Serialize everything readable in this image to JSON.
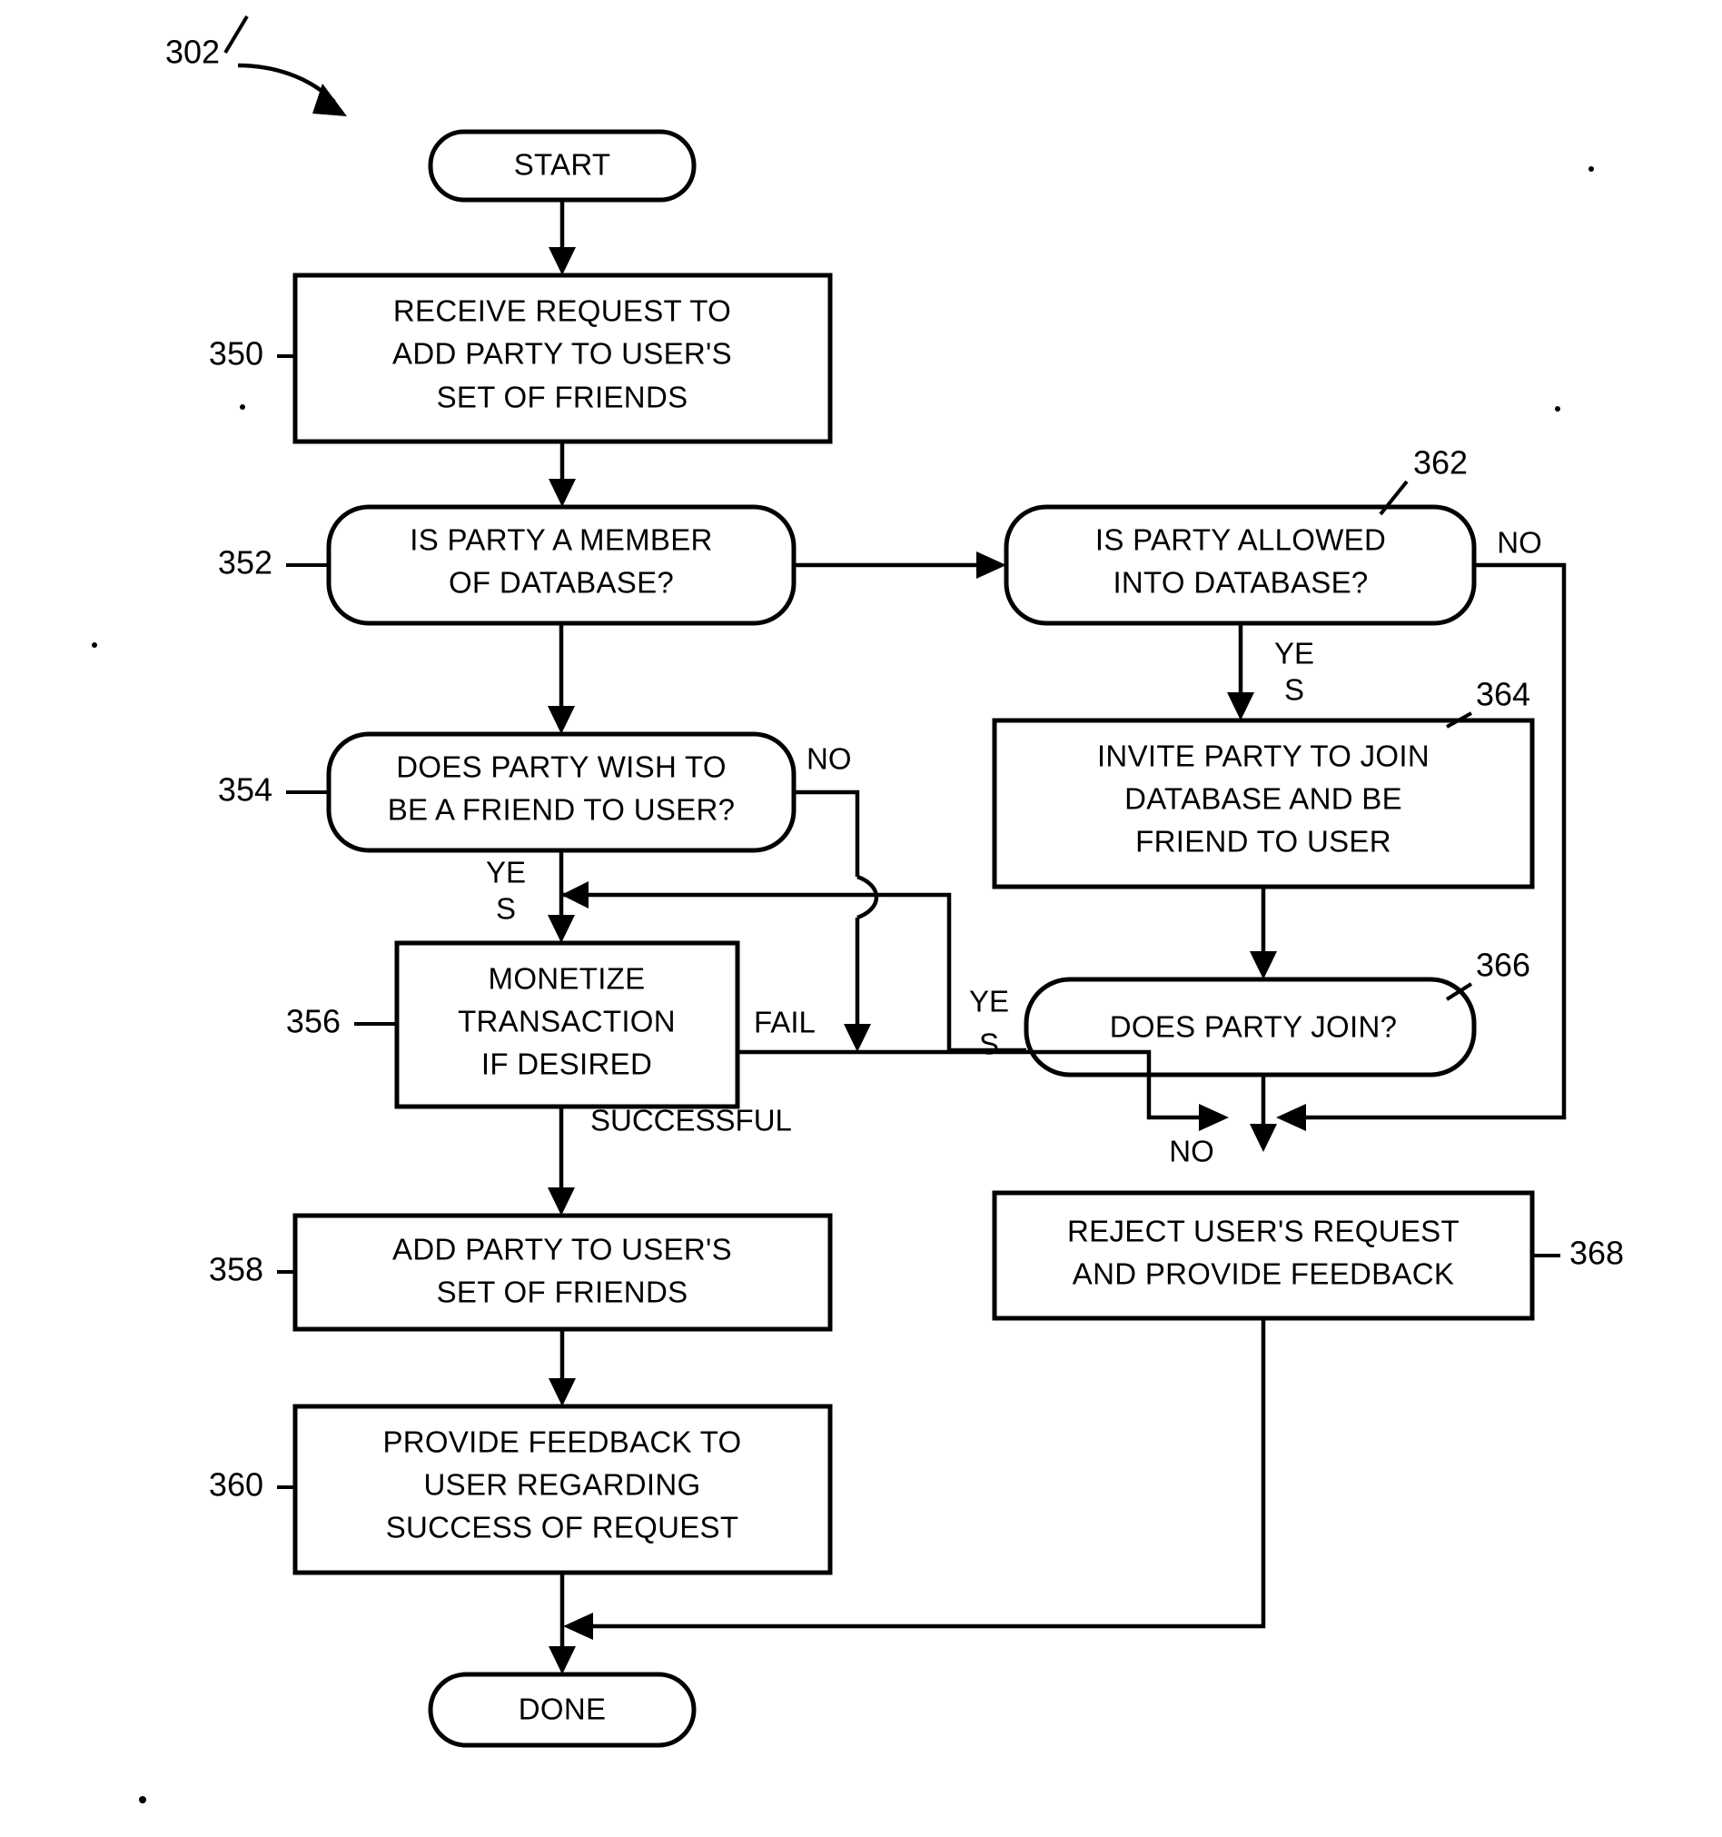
{
  "figure": {
    "reference_numeral": "302"
  },
  "nodes": {
    "start": {
      "label": "START",
      "shape": "rounded-terminal"
    },
    "n350": {
      "ref": "350",
      "lines": [
        "RECEIVE REQUEST TO",
        "ADD PARTY TO USER'S",
        "SET OF FRIENDS"
      ],
      "shape": "rectangle"
    },
    "n352": {
      "ref": "352",
      "lines": [
        "IS PARTY A MEMBER",
        "OF DATABASE?"
      ],
      "shape": "rounded-decision"
    },
    "n354": {
      "ref": "354",
      "lines": [
        "DOES PARTY WISH TO",
        "BE A FRIEND TO USER?"
      ],
      "shape": "rounded-decision"
    },
    "n356": {
      "ref": "356",
      "lines": [
        "MONETIZE",
        "TRANSACTION",
        "IF DESIRED"
      ],
      "shape": "rectangle"
    },
    "n358": {
      "ref": "358",
      "lines": [
        "ADD PARTY TO USER'S",
        "SET OF FRIENDS"
      ],
      "shape": "rectangle"
    },
    "n360": {
      "ref": "360",
      "lines": [
        "PROVIDE FEEDBACK TO",
        "USER REGARDING",
        "SUCCESS OF REQUEST"
      ],
      "shape": "rectangle"
    },
    "n362": {
      "ref": "362",
      "lines": [
        "IS PARTY ALLOWED",
        "INTO DATABASE?"
      ],
      "shape": "rounded-decision"
    },
    "n364": {
      "ref": "364",
      "lines": [
        "INVITE PARTY TO JOIN",
        "DATABASE AND BE",
        "FRIEND TO USER"
      ],
      "shape": "rectangle"
    },
    "n366": {
      "ref": "366",
      "lines": [
        "DOES PARTY JOIN?"
      ],
      "shape": "rounded-decision"
    },
    "n368": {
      "ref": "368",
      "lines": [
        "REJECT USER'S REQUEST",
        "AND PROVIDE FEEDBACK"
      ],
      "shape": "rectangle"
    },
    "done": {
      "label": "DONE",
      "shape": "rounded-terminal"
    }
  },
  "edge_labels": {
    "n352_no_to_362": "",
    "n354_no": "NO",
    "n354_yes_line1": "YE",
    "n354_yes_line2": "S",
    "n356_fail": "FAIL",
    "n356_successful": "SUCCESSFUL",
    "n362_no": "NO",
    "n362_yes_line1": "YE",
    "n362_yes_line2": "S",
    "n366_yes_line1": "YE",
    "n366_yes_line2": "S",
    "n366_no": "NO"
  },
  "colors": {
    "ink": "#000000",
    "paper": "#ffffff"
  }
}
